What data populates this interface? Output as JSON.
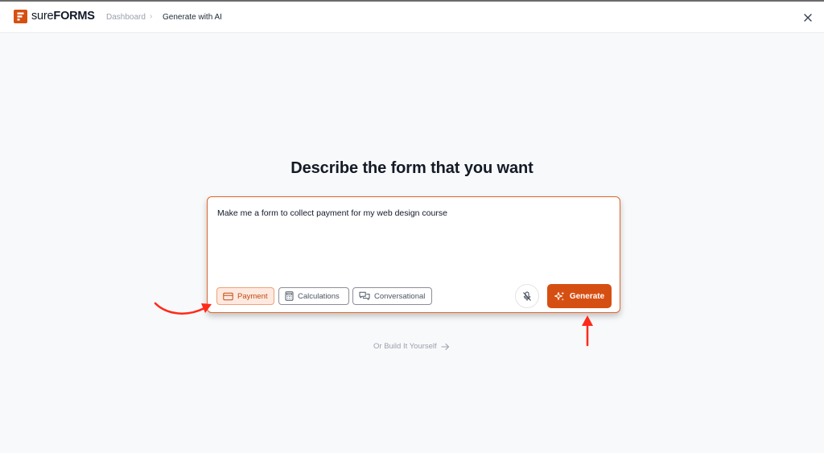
{
  "brand": {
    "name_light": "sure",
    "name_bold": "FORMS",
    "accent_color": "#d64f12"
  },
  "breadcrumb": {
    "items": [
      {
        "label": "Dashboard"
      },
      {
        "label": "Generate with AI"
      }
    ],
    "separator": "›"
  },
  "header": {
    "close_icon": "close-icon"
  },
  "main": {
    "title": "Describe the form that you want",
    "prompt": {
      "value": "Make me a form to collect payment for my web design course"
    },
    "chips": [
      {
        "label": "Payment",
        "icon": "credit-card-icon",
        "selected": true
      },
      {
        "label": "Calculations",
        "icon": "calculator-icon",
        "selected": false
      },
      {
        "label": "Conversational",
        "icon": "chat-bubbles-icon",
        "selected": false
      }
    ],
    "mic_icon": "microphone-off-icon",
    "generate_label": "Generate",
    "generate_icon": "sparkles-icon",
    "build_link_label": "Or Build It Yourself",
    "build_link_icon": "arrow-right-icon"
  },
  "annotations": {
    "arrow_color": "#ff2a1a"
  }
}
